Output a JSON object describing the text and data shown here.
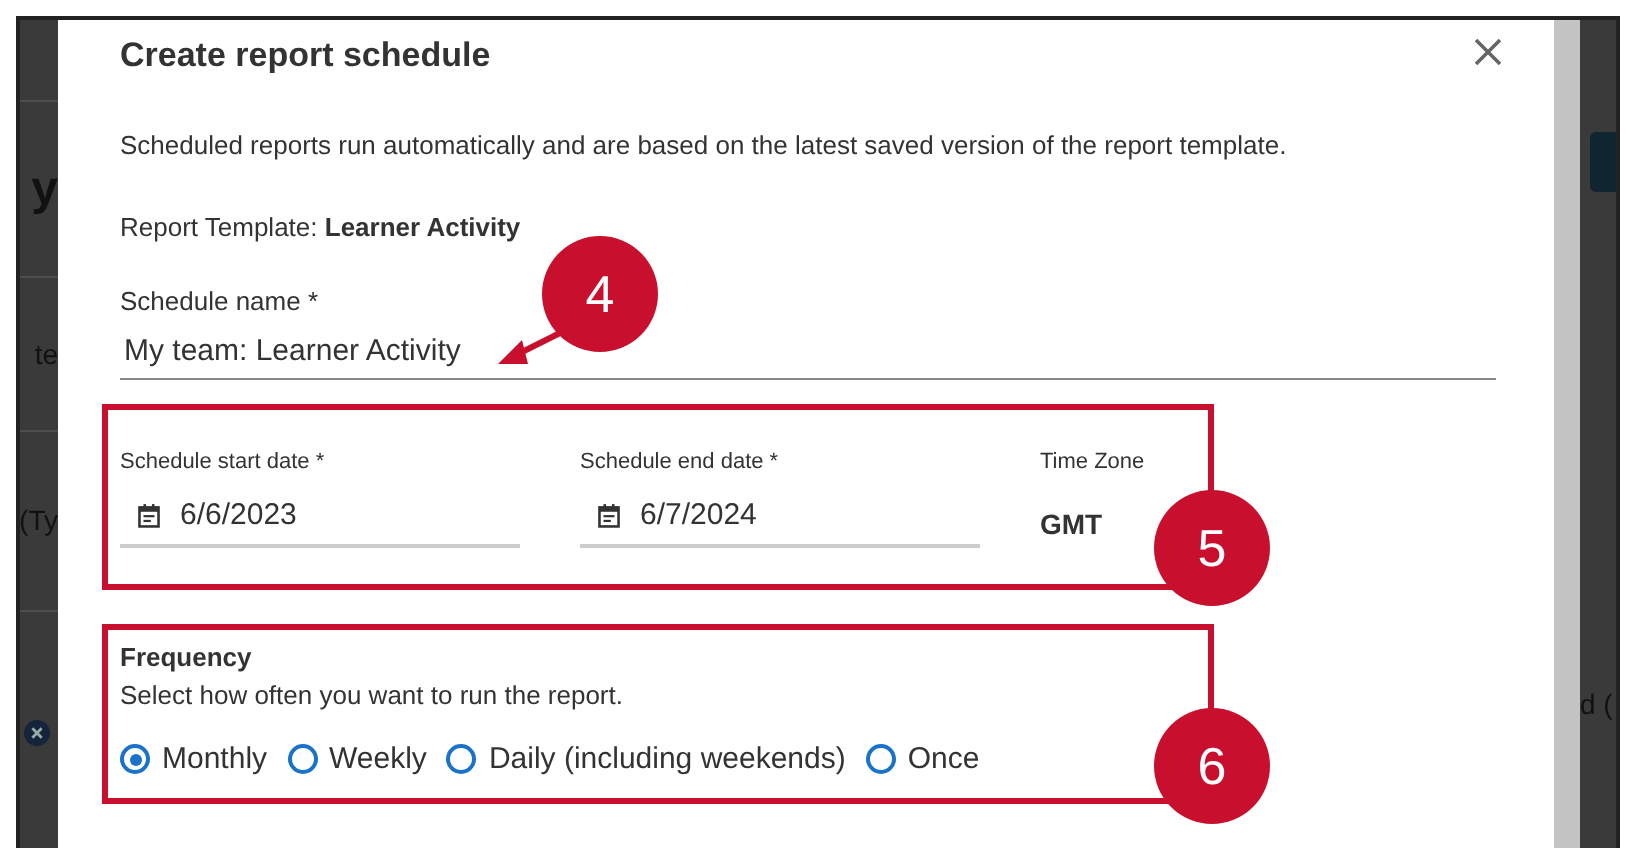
{
  "background_page": {
    "left_fragments": [
      "y",
      "te",
      "(Ty"
    ],
    "right_fragments": [
      "d ("
    ]
  },
  "dialog": {
    "title": "Create report schedule",
    "description": "Scheduled reports run automatically and are based on the latest saved version of the report template.",
    "template": "Report Template: **Learner Activity**",
    "name_field": {
      "label": "Schedule name *",
      "value": "My team: Learner Activity"
    },
    "dates": [
      {
        "label": "Schedule start date *",
        "value": "6/6/2023"
      },
      {
        "label": "Schedule end date *",
        "value": "6/7/2024"
      }
    ],
    "time_zone": {
      "label": "Time Zone",
      "value": "GMT"
    },
    "frequency": {
      "title": "Frequency",
      "hint": "Select how often you want to run the report.",
      "options": [
        {
          "label": "Monthly",
          "selected": true
        },
        {
          "label": "Weekly",
          "selected": false
        },
        {
          "label": "Daily (including weekends)",
          "selected": false
        },
        {
          "label": "Once",
          "selected": false
        }
      ]
    }
  },
  "callouts": [
    {
      "number": "4"
    },
    {
      "number": "5"
    },
    {
      "number": "6"
    }
  ]
}
